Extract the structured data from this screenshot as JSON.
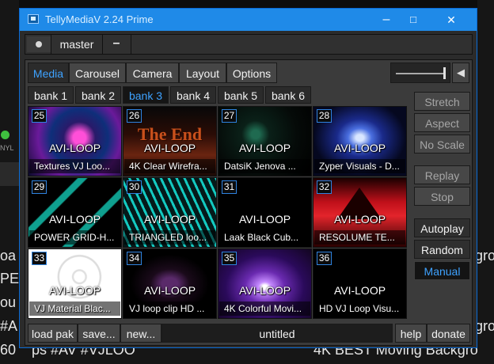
{
  "window": {
    "title": "TellyMediaV 2.24 Prime",
    "minimize_glyph": "–",
    "maximize_glyph": "□",
    "close_glyph": "✕"
  },
  "topbar": {
    "preset_name": "master",
    "minus_label": "–"
  },
  "tabs": [
    "Media",
    "Carousel",
    "Camera",
    "Layout",
    "Options"
  ],
  "active_tab": "Media",
  "volume": {
    "level": 1.0,
    "speaker_glyph": "◀"
  },
  "banks": [
    "bank 1",
    "bank 2",
    "bank 3",
    "bank 4",
    "bank 5",
    "bank 6"
  ],
  "active_bank": "bank 3",
  "cells": [
    {
      "num": "25",
      "type": "AVI-LOOP",
      "caption": "Textures VJ Loo..."
    },
    {
      "num": "26",
      "type": "AVI-LOOP",
      "caption": "4K Clear Wirefra...",
      "overlay": "The End"
    },
    {
      "num": "27",
      "type": "AVI-LOOP",
      "caption": "DatsiK   Jenova ..."
    },
    {
      "num": "28",
      "type": "AVI-LOOP",
      "caption": "Zyper Visuals - D..."
    },
    {
      "num": "29",
      "type": "AVI-LOOP",
      "caption": "POWER GRID-H..."
    },
    {
      "num": "30",
      "type": "AVI-LOOP",
      "caption": "TRIANGLED loo..."
    },
    {
      "num": "31",
      "type": "AVI-LOOP",
      "caption": "Laak Black Cub..."
    },
    {
      "num": "32",
      "type": "AVI-LOOP",
      "caption": "RESOLUME TE..."
    },
    {
      "num": "33",
      "type": "AVI-LOOP",
      "caption": "VJ Material  Blac..."
    },
    {
      "num": "34",
      "type": "AVI-LOOP",
      "caption": "VJ loop clip HD ..."
    },
    {
      "num": "35",
      "type": "AVI-LOOP",
      "caption": "4K Colorful Movi..."
    },
    {
      "num": "36",
      "type": "AVI-LOOP",
      "caption": "HD VJ Loop Visu..."
    }
  ],
  "side_buttons": {
    "stretch": "Stretch",
    "aspect": "Aspect",
    "no_scale": "No Scale",
    "replay": "Replay",
    "stop": "Stop",
    "autoplay": "Autoplay",
    "random": "Random",
    "manual": "Manual"
  },
  "bottom": {
    "load_pak": "load pak",
    "save": "save...",
    "new": "new...",
    "pak_name": "untitled",
    "help": "help",
    "donate": "donate"
  },
  "background_text": {
    "left_1": "oa",
    "left_2": "PE",
    "left_3": "ou",
    "left_4": "#A",
    "left_5": "60",
    "right_1": "gro",
    "right_2": "gro",
    "bottom_line": "ps #AV #VJLOO",
    "bottom_right": "4K BEST Moving Backgro",
    "small_label": "NYL"
  },
  "colors": {
    "titlebar": "#1f8ae8",
    "accent_blue": "#3ea2ff",
    "panel": "#3b3b3b"
  }
}
